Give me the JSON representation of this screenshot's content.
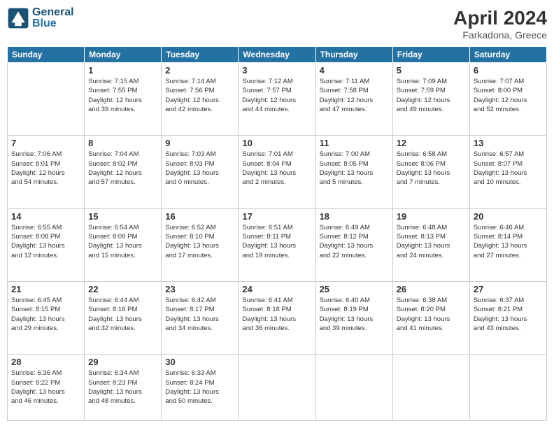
{
  "header": {
    "logo_general": "General",
    "logo_blue": "Blue",
    "main_title": "April 2024",
    "subtitle": "Farkadona, Greece"
  },
  "weekdays": [
    "Sunday",
    "Monday",
    "Tuesday",
    "Wednesday",
    "Thursday",
    "Friday",
    "Saturday"
  ],
  "weeks": [
    [
      {
        "day": "",
        "info": ""
      },
      {
        "day": "1",
        "info": "Sunrise: 7:15 AM\nSunset: 7:55 PM\nDaylight: 12 hours\nand 39 minutes."
      },
      {
        "day": "2",
        "info": "Sunrise: 7:14 AM\nSunset: 7:56 PM\nDaylight: 12 hours\nand 42 minutes."
      },
      {
        "day": "3",
        "info": "Sunrise: 7:12 AM\nSunset: 7:57 PM\nDaylight: 12 hours\nand 44 minutes."
      },
      {
        "day": "4",
        "info": "Sunrise: 7:11 AM\nSunset: 7:58 PM\nDaylight: 12 hours\nand 47 minutes."
      },
      {
        "day": "5",
        "info": "Sunrise: 7:09 AM\nSunset: 7:59 PM\nDaylight: 12 hours\nand 49 minutes."
      },
      {
        "day": "6",
        "info": "Sunrise: 7:07 AM\nSunset: 8:00 PM\nDaylight: 12 hours\nand 52 minutes."
      }
    ],
    [
      {
        "day": "7",
        "info": "Sunrise: 7:06 AM\nSunset: 8:01 PM\nDaylight: 12 hours\nand 54 minutes."
      },
      {
        "day": "8",
        "info": "Sunrise: 7:04 AM\nSunset: 8:02 PM\nDaylight: 12 hours\nand 57 minutes."
      },
      {
        "day": "9",
        "info": "Sunrise: 7:03 AM\nSunset: 8:03 PM\nDaylight: 13 hours\nand 0 minutes."
      },
      {
        "day": "10",
        "info": "Sunrise: 7:01 AM\nSunset: 8:04 PM\nDaylight: 13 hours\nand 2 minutes."
      },
      {
        "day": "11",
        "info": "Sunrise: 7:00 AM\nSunset: 8:05 PM\nDaylight: 13 hours\nand 5 minutes."
      },
      {
        "day": "12",
        "info": "Sunrise: 6:58 AM\nSunset: 8:06 PM\nDaylight: 13 hours\nand 7 minutes."
      },
      {
        "day": "13",
        "info": "Sunrise: 6:57 AM\nSunset: 8:07 PM\nDaylight: 13 hours\nand 10 minutes."
      }
    ],
    [
      {
        "day": "14",
        "info": "Sunrise: 6:55 AM\nSunset: 8:08 PM\nDaylight: 13 hours\nand 12 minutes."
      },
      {
        "day": "15",
        "info": "Sunrise: 6:54 AM\nSunset: 8:09 PM\nDaylight: 13 hours\nand 15 minutes."
      },
      {
        "day": "16",
        "info": "Sunrise: 6:52 AM\nSunset: 8:10 PM\nDaylight: 13 hours\nand 17 minutes."
      },
      {
        "day": "17",
        "info": "Sunrise: 6:51 AM\nSunset: 8:11 PM\nDaylight: 13 hours\nand 19 minutes."
      },
      {
        "day": "18",
        "info": "Sunrise: 6:49 AM\nSunset: 8:12 PM\nDaylight: 13 hours\nand 22 minutes."
      },
      {
        "day": "19",
        "info": "Sunrise: 6:48 AM\nSunset: 8:13 PM\nDaylight: 13 hours\nand 24 minutes."
      },
      {
        "day": "20",
        "info": "Sunrise: 6:46 AM\nSunset: 8:14 PM\nDaylight: 13 hours\nand 27 minutes."
      }
    ],
    [
      {
        "day": "21",
        "info": "Sunrise: 6:45 AM\nSunset: 8:15 PM\nDaylight: 13 hours\nand 29 minutes."
      },
      {
        "day": "22",
        "info": "Sunrise: 6:44 AM\nSunset: 8:16 PM\nDaylight: 13 hours\nand 32 minutes."
      },
      {
        "day": "23",
        "info": "Sunrise: 6:42 AM\nSunset: 8:17 PM\nDaylight: 13 hours\nand 34 minutes."
      },
      {
        "day": "24",
        "info": "Sunrise: 6:41 AM\nSunset: 8:18 PM\nDaylight: 13 hours\nand 36 minutes."
      },
      {
        "day": "25",
        "info": "Sunrise: 6:40 AM\nSunset: 8:19 PM\nDaylight: 13 hours\nand 39 minutes."
      },
      {
        "day": "26",
        "info": "Sunrise: 6:38 AM\nSunset: 8:20 PM\nDaylight: 13 hours\nand 41 minutes."
      },
      {
        "day": "27",
        "info": "Sunrise: 6:37 AM\nSunset: 8:21 PM\nDaylight: 13 hours\nand 43 minutes."
      }
    ],
    [
      {
        "day": "28",
        "info": "Sunrise: 6:36 AM\nSunset: 8:22 PM\nDaylight: 13 hours\nand 46 minutes."
      },
      {
        "day": "29",
        "info": "Sunrise: 6:34 AM\nSunset: 8:23 PM\nDaylight: 13 hours\nand 48 minutes."
      },
      {
        "day": "30",
        "info": "Sunrise: 6:33 AM\nSunset: 8:24 PM\nDaylight: 13 hours\nand 50 minutes."
      },
      {
        "day": "",
        "info": ""
      },
      {
        "day": "",
        "info": ""
      },
      {
        "day": "",
        "info": ""
      },
      {
        "day": "",
        "info": ""
      }
    ]
  ]
}
